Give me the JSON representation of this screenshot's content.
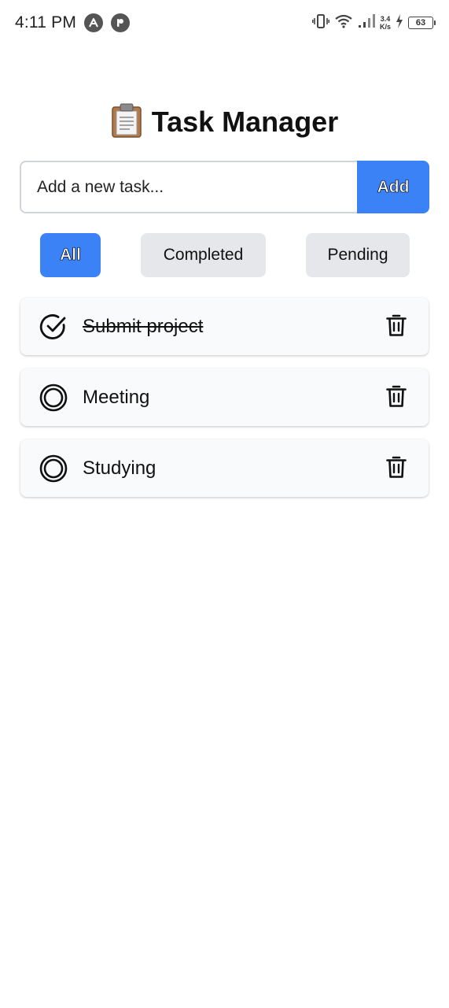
{
  "status_bar": {
    "time": "4:11 PM",
    "speed_value": "3.4",
    "speed_unit": "K/s",
    "battery": "63",
    "icons": [
      "notification-a-icon",
      "notification-app-icon",
      "vibrate-icon",
      "wifi-icon",
      "signal-icon",
      "charging-icon",
      "battery-icon"
    ]
  },
  "header": {
    "emoji": "📋",
    "title": "Task Manager"
  },
  "new_task": {
    "placeholder": "Add a new task...",
    "value": "",
    "add_label": "Add"
  },
  "filters": {
    "active": "All",
    "items": [
      {
        "label": "All"
      },
      {
        "label": "Completed"
      },
      {
        "label": "Pending"
      }
    ]
  },
  "tasks": [
    {
      "label": "Submit project",
      "completed": true
    },
    {
      "label": "Meeting",
      "completed": false
    },
    {
      "label": "Studying",
      "completed": false
    }
  ],
  "colors": {
    "accent": "#3b82f6",
    "filter_inactive": "#e5e7eb",
    "card_bg": "#f9fafb",
    "input_border": "#d1d5db"
  }
}
